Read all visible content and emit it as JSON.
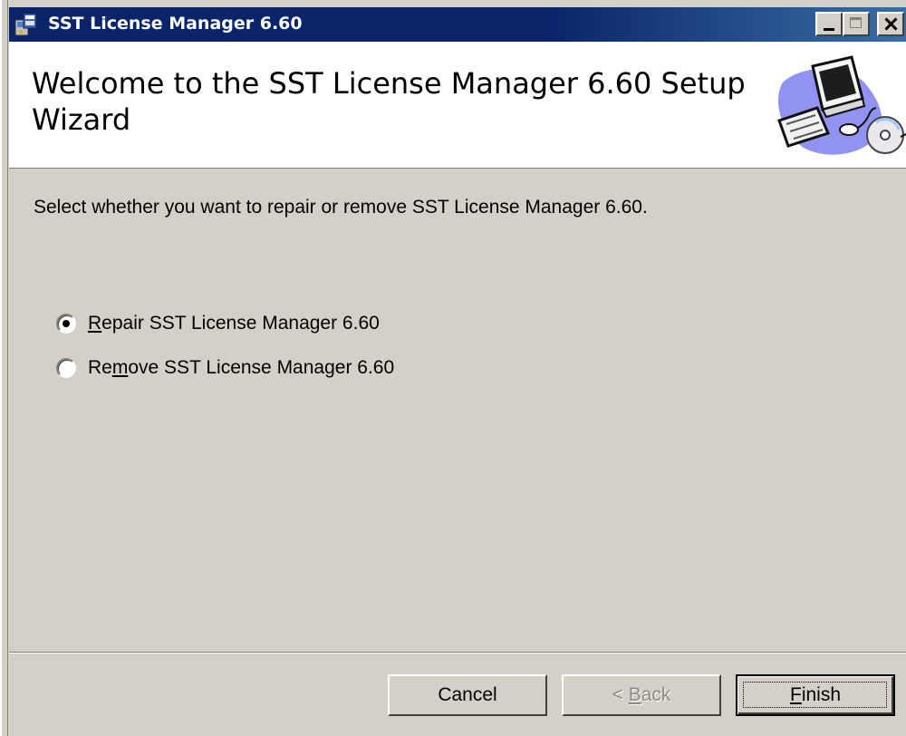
{
  "window": {
    "title": "SST License Manager 6.60",
    "controls": [
      "minimize",
      "maximize",
      "close"
    ]
  },
  "banner": {
    "heading": "Welcome to the SST License Manager 6.60 Setup Wizard",
    "art_icon": "computer-cd-icon"
  },
  "instruction": "Select whether you want to repair or remove SST License Manager 6.60.",
  "options": [
    {
      "mnemonic": "R",
      "rest": "epair SST License Manager 6.60",
      "pre": "",
      "selected": true
    },
    {
      "pre": "Re",
      "mnemonic": "m",
      "rest": "ove SST License Manager 6.60",
      "selected": false
    }
  ],
  "buttons": {
    "cancel": "Cancel",
    "back_prefix": "< ",
    "back_mnemonic": "B",
    "back_rest": "ack",
    "finish_mnemonic": "F",
    "finish_rest": "inish"
  },
  "colors": {
    "title_bar": "#0a246a",
    "face": "#d4d0c8",
    "banner": "#ffffff"
  }
}
